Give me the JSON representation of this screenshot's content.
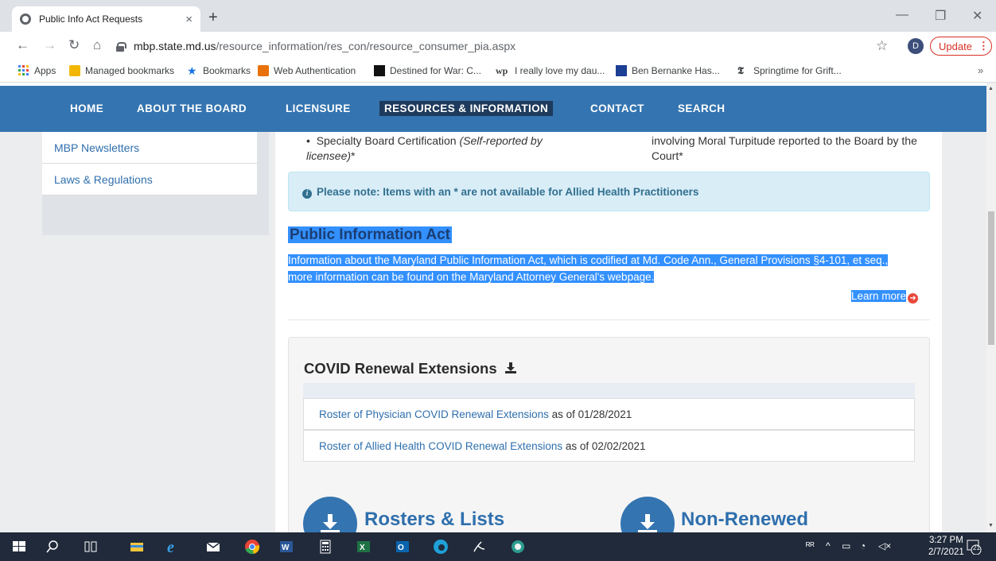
{
  "browser": {
    "tab_title": "Public Info Act Requests",
    "tab_close": "×",
    "new_tab": "+",
    "url_host": "mbp.state.md.us",
    "url_path": "/resource_information/res_con/resource_consumer_pia.aspx",
    "profile_initial": "D",
    "update_label": "Update",
    "bookmarks": [
      {
        "label": "Apps"
      },
      {
        "label": "Managed bookmarks"
      },
      {
        "label": "Bookmarks"
      },
      {
        "label": "Web Authentication"
      },
      {
        "label": "Destined for War: C..."
      },
      {
        "label": "I really love my dau..."
      },
      {
        "label": "Ben Bernanke Has..."
      },
      {
        "label": "Springtime for Grift..."
      }
    ],
    "bookmarks_more": "»"
  },
  "site_nav": {
    "items": [
      {
        "label": "HOME"
      },
      {
        "label": "ABOUT THE BOARD"
      },
      {
        "label": "LICENSURE"
      },
      {
        "label": "RESOURCES & INFORMATION"
      },
      {
        "label": "CONTACT"
      },
      {
        "label": "SEARCH"
      }
    ],
    "active_index": 3
  },
  "sidebar": {
    "items": [
      {
        "label": "MBP Newsletters"
      },
      {
        "label": "Laws & Regulations"
      }
    ]
  },
  "content": {
    "bullet_left_main": "Specialty Board Certification ",
    "bullet_left_italic": "(Self-reported by licensee)",
    "bullet_left_suffix": "*",
    "bullet_right": "involving Moral Turpitude reported to the Board by the Court*",
    "note": "Please note: Items with an * are not available for Allied Health Practitioners",
    "pia_title": "Public Information Act",
    "pia_line1": "Information about the Maryland Public Information Act, which is codified at Md. Code Ann., General Provisions §4-101, et seq.,",
    "pia_line2": "more information can be found on the Maryland Attorney General's webpage.",
    "learn_more": "Learn more"
  },
  "covid": {
    "title": "COVID Renewal Extensions",
    "items": [
      {
        "link": "Roster of Physician COVID Renewal Extensions",
        "suffix": " as of 01/28/2021"
      },
      {
        "link": "Roster of Allied Health COVID Renewal Extensions",
        "suffix": " as of 02/02/2021"
      }
    ]
  },
  "tiles": [
    {
      "label": "Rosters & Lists"
    },
    {
      "label": "Non-Renewed"
    }
  ],
  "taskbar": {
    "time": "3:27 PM",
    "date": "2/7/2021",
    "notification_count": "21"
  },
  "colors": {
    "nav_blue": "#3474b0",
    "active_nav": "#1e3a5c",
    "link_blue": "#2f6fad",
    "selection": "#3390ff",
    "alert_bg": "#d9edf7"
  }
}
